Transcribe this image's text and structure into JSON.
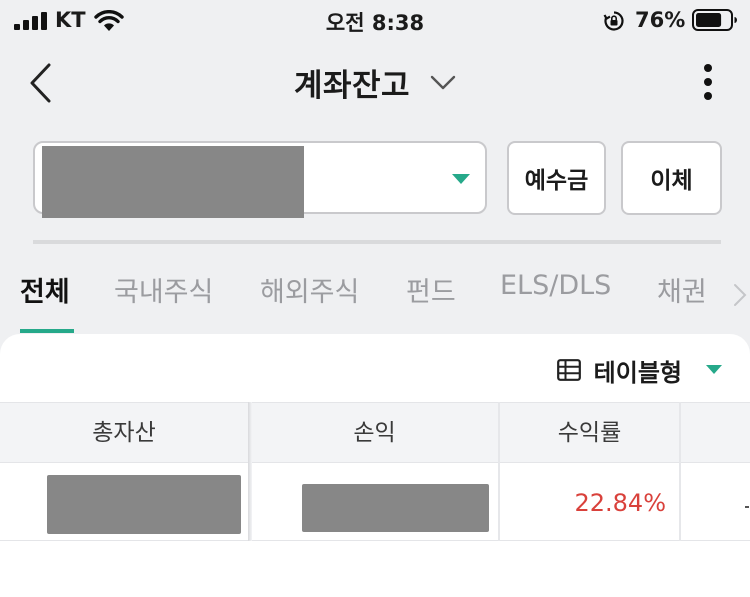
{
  "status_bar": {
    "carrier": "KT",
    "time": "오전 8:38",
    "battery_percent": "76%",
    "battery_level": 0.76
  },
  "header": {
    "title": "계좌잔고",
    "back_icon": "chevron-left-icon",
    "title_dropdown_icon": "chevron-down-icon",
    "more_icon": "vertical-dots-icon"
  },
  "account": {
    "dropdown_icon": "caret-down-icon",
    "deposit_label": "예수금",
    "transfer_label": "이체"
  },
  "tabs": [
    {
      "label": "전체",
      "active": true
    },
    {
      "label": "국내주식",
      "active": false
    },
    {
      "label": "해외주식",
      "active": false
    },
    {
      "label": "펀드",
      "active": false
    },
    {
      "label": "ELS/DLS",
      "active": false
    },
    {
      "label": "채권",
      "active": false
    }
  ],
  "view": {
    "label": "테이블형",
    "icon": "table-icon"
  },
  "table": {
    "columns": [
      "총자산",
      "손익",
      "수익률"
    ],
    "rows": [
      {
        "total_assets": "",
        "profit_loss": "",
        "return_rate": "22.84%"
      }
    ]
  },
  "colors": {
    "accent": "#26a98a",
    "positive": "#d9413b",
    "background": "#eff0f2"
  }
}
